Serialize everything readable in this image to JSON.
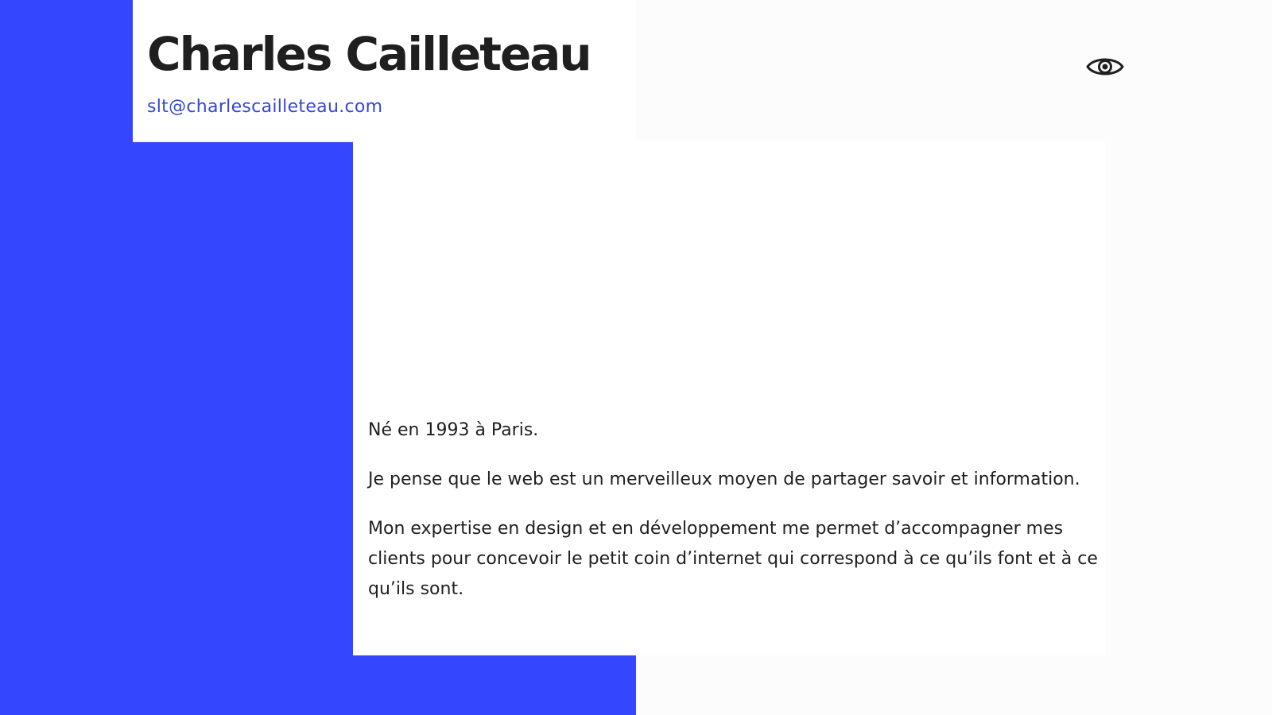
{
  "header": {
    "name": "Charles Cailleteau",
    "email": "slt@charlescailleteau.com"
  },
  "bio": {
    "paragraphs": [
      "Né en 1993 à Paris.",
      "Je pense que le web est un merveilleux moyen de partager savoir et information.",
      "Mon expertise en design et en développement me permet d’accompagner mes clients pour concevoir le petit coin d’internet qui correspond à ce qu’ils font et à ce qu’ils sont."
    ]
  },
  "icons": {
    "view_toggle": "eye-icon"
  },
  "colors": {
    "accent_blue": "#3447ff",
    "link_blue": "#3447d9",
    "text": "#1f1f1f",
    "background": "#fcfcfd"
  }
}
